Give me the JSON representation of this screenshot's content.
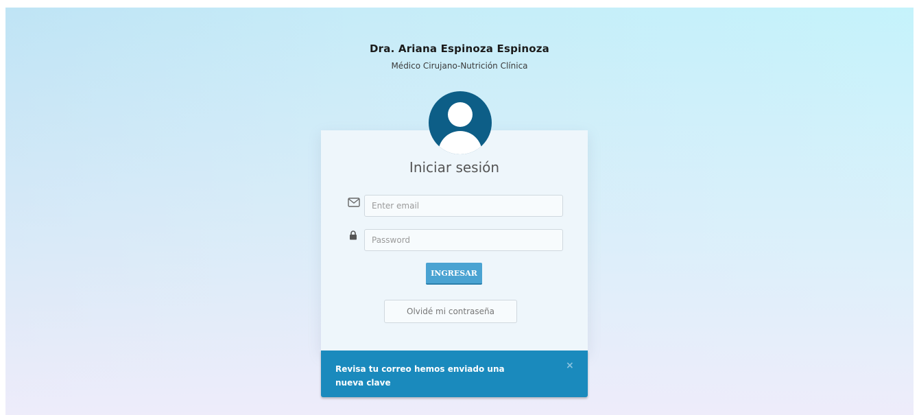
{
  "header": {
    "doctor_name": "Dra. Ariana Espinoza Espinoza",
    "doctor_title": "Médico Cirujano-Nutrición Clínica"
  },
  "login": {
    "title": "Iniciar sesión",
    "email_placeholder": "Enter email",
    "email_value": "",
    "password_placeholder": "Password",
    "password_value": "",
    "submit_label": "INGRESAR",
    "forgot_label": "Olvidé mi contraseña"
  },
  "alert": {
    "message": "Revisa tu correo hemos enviado una nueva clave",
    "close_label": "×"
  },
  "icons": {
    "avatar": "user-avatar-icon",
    "email": "envelope-icon",
    "password": "lock-icon"
  },
  "colors": {
    "avatar": "#0d5e87",
    "submit_button": "#4aa3d2",
    "alert_background": "#1a8abd"
  }
}
